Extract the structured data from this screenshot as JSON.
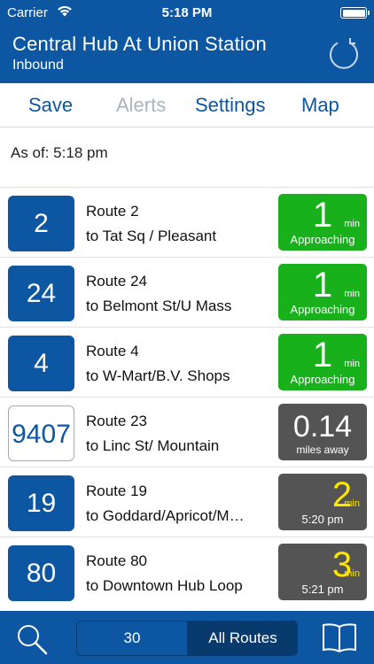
{
  "status": {
    "carrier": "Carrier",
    "time": "5:18 PM"
  },
  "header": {
    "stop_name": "Central Hub At Union Station",
    "direction": "Inbound",
    "refresh_icon": "refresh-icon"
  },
  "toolbar": {
    "save": "Save",
    "alerts": "Alerts",
    "settings": "Settings",
    "map": "Map"
  },
  "as_of": "As of: 5:18 pm",
  "routes": [
    {
      "number": "2",
      "name": "Route 2",
      "destination": "to Tat Sq / Pleasant",
      "eta_value": "1",
      "eta_unit": "min",
      "eta_sub": "Approaching"
    },
    {
      "number": "24",
      "name": "Route 24",
      "destination": "to Belmont St/U Mass",
      "eta_value": "1",
      "eta_unit": "min",
      "eta_sub": "Approaching"
    },
    {
      "number": "4",
      "name": "Route 4",
      "destination": "to W-Mart/B.V. Shops",
      "eta_value": "1",
      "eta_unit": "min",
      "eta_sub": "Approaching"
    },
    {
      "number": "9407",
      "name": "Route 23",
      "destination": "to Linc St/ Mountain",
      "eta_value": "0.14",
      "eta_sub": "miles away"
    },
    {
      "number": "19",
      "name": "Route 19",
      "destination": "to Goddard/Apricot/M…",
      "eta_value": "2",
      "eta_unit": "min",
      "eta_sub": "5:20 pm"
    },
    {
      "number": "80",
      "name": "Route 80",
      "destination": "to Downtown Hub Loop",
      "eta_value": "3",
      "eta_unit": "min",
      "eta_sub": "5:21 pm"
    }
  ],
  "bottom": {
    "count": "30",
    "filter": "All Routes"
  },
  "colors": {
    "brand": "#0c56a2",
    "approaching": "#18b11c",
    "scheduled": "#545454",
    "scheduled_text": "#ffe600"
  }
}
